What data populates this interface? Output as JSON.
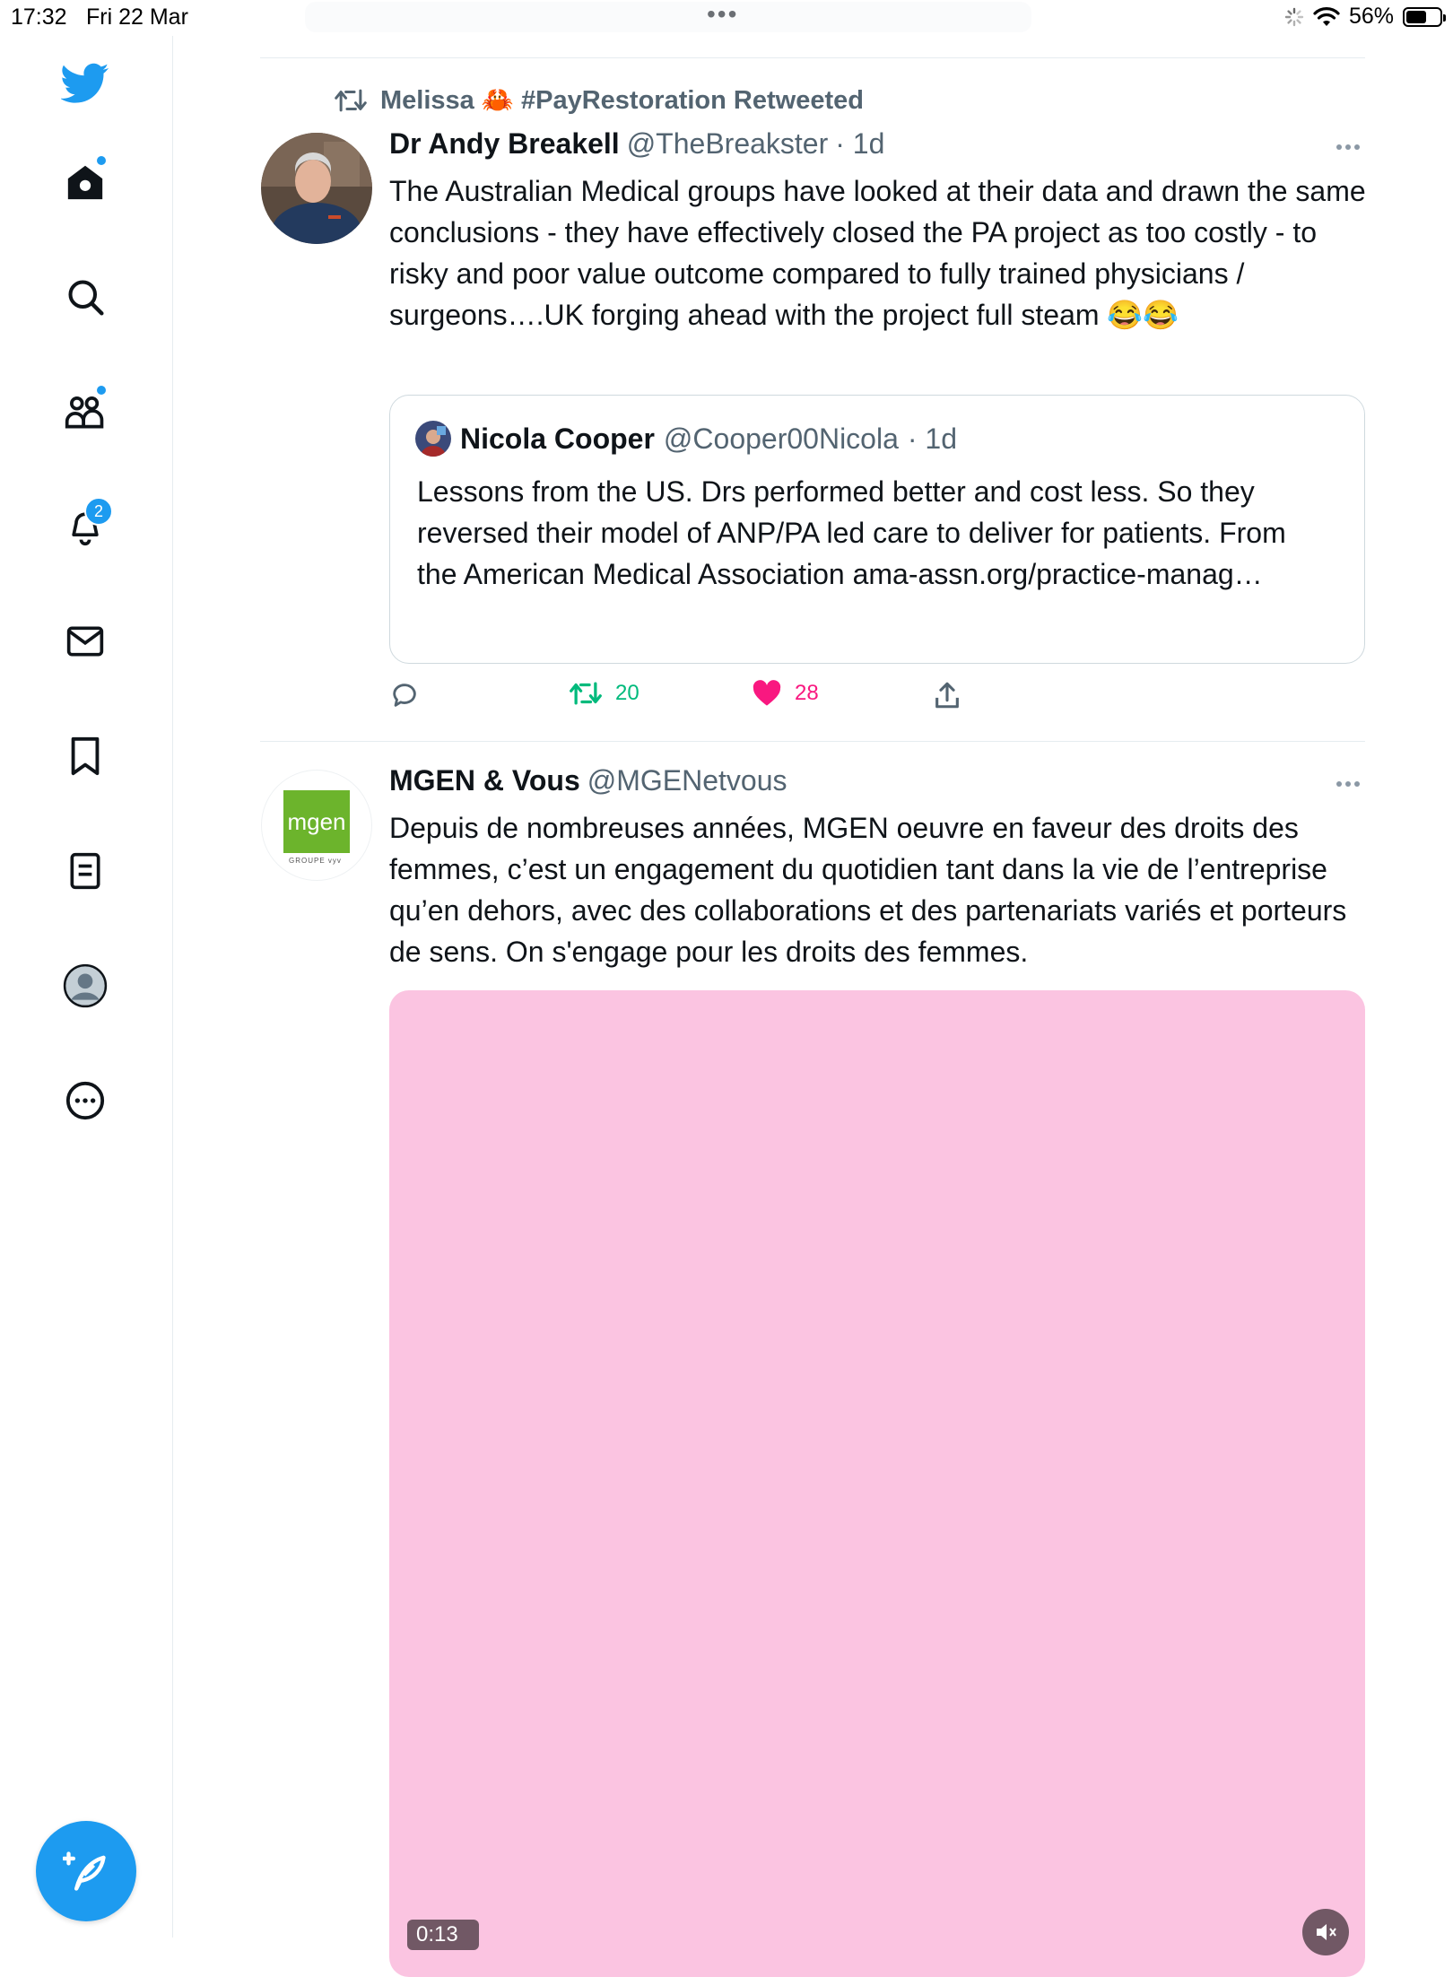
{
  "status_bar": {
    "time": "17:32",
    "date": "Fri 22 Mar",
    "battery": "56%",
    "battery_level": 0.56
  },
  "sidebar": {
    "notifications_badge": "2"
  },
  "feed": [
    {
      "retweeted_by": "Melissa 🦀 #PayRestoration Retweeted",
      "name": "Dr Andy Breakell",
      "handle": "@TheBreakster",
      "time": "· 1d",
      "text": "The Australian Medical groups have looked at their data and drawn the same conclusions - they have effectively closed the PA project as too costly - to risky and poor value outcome compared to fully trained physicians / surgeons….UK forging ahead with the project full steam 😂😂",
      "quote": {
        "name": "Nicola Cooper",
        "handle": "@Cooper00Nicola",
        "time": "· 1d",
        "text": "Lessons from the US. Drs performed better and cost less. So they reversed their model of ANP/PA led care to deliver for patients. From the American Medical Association ama-assn.org/practice-manag…"
      },
      "retweets": "20",
      "likes": "28"
    },
    {
      "name": "MGEN & Vous",
      "handle": "@MGENetvous",
      "avatar_text": "mgen",
      "avatar_sub": "GROUPE vyv",
      "text": "Depuis de nombreuses années, MGEN oeuvre en faveur des droits des femmes, c’est un engagement du quotidien tant dans la vie de l’entreprise qu’en dehors, avec des collaborations et des partenariats variés et porteurs de sens.  On s'engage pour les droits des femmes.",
      "video_time": "0:13"
    }
  ],
  "colors": {
    "accent": "#1d9bf0",
    "retweet": "#00ba7c",
    "like": "#f91880",
    "media": "#fbc4e1",
    "mgen_green": "#6cb42c"
  }
}
